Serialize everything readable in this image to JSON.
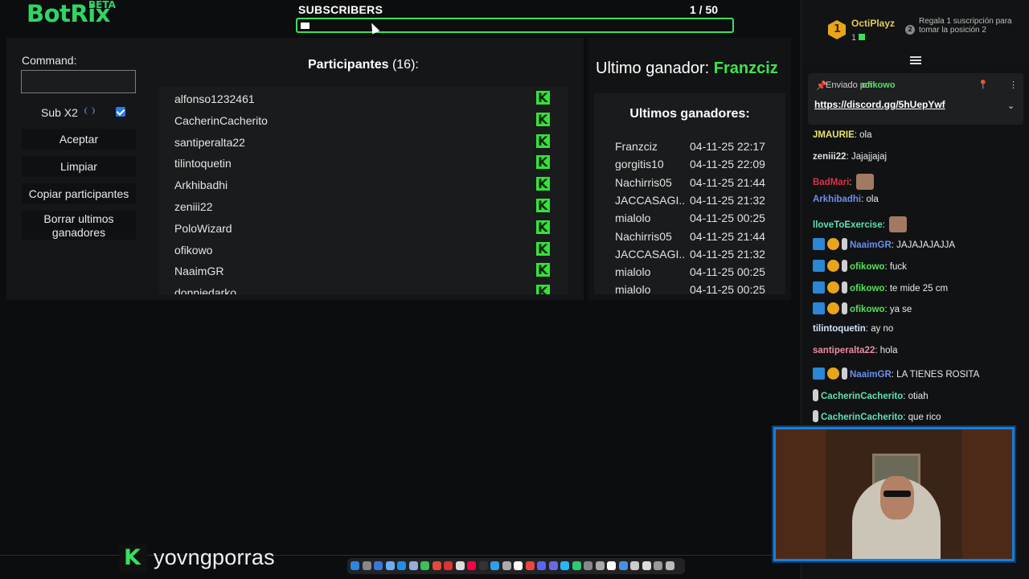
{
  "botrix": {
    "logo": "BotRix",
    "beta": "BETA"
  },
  "subscribers": {
    "label": "SUBSCRIBERS",
    "count": "1  / 50",
    "progress": 0.02
  },
  "form": {
    "command_label": "Command:",
    "command_value": "",
    "subx2_label": "Sub X2",
    "subx2_checked": true,
    "buttons": {
      "accept": "Aceptar",
      "clear": "Limpiar",
      "copy": "Copiar participantes",
      "delete_line1": "Borrar ultimos",
      "delete_line2": "ganadores"
    }
  },
  "participants": {
    "title": "Participantes",
    "count": "(16):",
    "names": [
      "alfonso1232461",
      "CacherinCacherito",
      "santiperalta22",
      "tilintoquetin",
      "Arkhibadhi",
      "zeniii22",
      "PoloWizard",
      "ofikowo",
      "NaaimGR",
      "donniedarko"
    ]
  },
  "winners": {
    "last_label": "Ultimo ganador:",
    "last_name": "Franzciz",
    "list_title": "Ultimos ganadores:",
    "rows": [
      {
        "name": "Franzciz",
        "date": "04-11-25 22:17"
      },
      {
        "name": "gorgitis10",
        "date": "04-11-25 22:09"
      },
      {
        "name": "Nachirris05",
        "date": "04-11-25 21:44"
      },
      {
        "name": "JACCASAGI...",
        "date": "04-11-25 21:32"
      },
      {
        "name": "mialolo",
        "date": "04-11-25 00:25"
      },
      {
        "name": "Nachirris05",
        "date": "04-11-25 21:44"
      },
      {
        "name": "JACCASAGI...",
        "date": "04-11-25 21:32"
      },
      {
        "name": "mialolo",
        "date": "04-11-25 00:25"
      },
      {
        "name": "mialolo",
        "date": "04-11-25 00:25"
      }
    ]
  },
  "stream": {
    "channel": "yovngporras"
  },
  "chat": {
    "gifter": {
      "name": "OctiPlayz",
      "count": "1",
      "rank": "2",
      "badge_num": "1",
      "text": "Regala 1 suscripción para tomar la posición 2"
    },
    "pinned": {
      "by_label": "Enviado por",
      "user": "ofikowo",
      "link": "https://discord.gg/5hUepYwf"
    },
    "messages": [
      {
        "user": "JMAURIE",
        "color": "#e8e36a",
        "text": "ola",
        "badges": []
      },
      {
        "user": "zeniii22",
        "color": "#e0e0e0",
        "text": "Jajajjajaj",
        "badges": []
      },
      {
        "user": "BadMari",
        "color": "#d8334a",
        "text": "",
        "badges": [],
        "emote": true
      },
      {
        "user": "Arkhibadhi",
        "color": "#6b8ff0",
        "text": "ola",
        "badges": []
      },
      {
        "user": "lloveToExercise",
        "color": "#5fe0b2",
        "text": "",
        "badges": [],
        "emote": true
      },
      {
        "user": "NaaimGR",
        "color": "#6b8ff0",
        "text": "JAJAJAJAJJA",
        "badges": [
          "mod",
          "sub",
          "gift"
        ]
      },
      {
        "user": "ofikowo",
        "color": "#53e05a",
        "text": "fuck",
        "badges": [
          "mod",
          "sub",
          "gift"
        ]
      },
      {
        "user": "ofikowo",
        "color": "#53e05a",
        "text": "te mide 25 cm",
        "badges": [
          "mod",
          "sub",
          "gift"
        ]
      },
      {
        "user": "ofikowo",
        "color": "#53e05a",
        "text": "ya se",
        "badges": [
          "mod",
          "sub",
          "gift"
        ]
      },
      {
        "user": "tilintoquetin",
        "color": "#cfe4ff",
        "text": "ay no",
        "badges": []
      },
      {
        "user": "santiperalta22",
        "color": "#ef8aa6",
        "text": "hola",
        "badges": []
      },
      {
        "user": "NaaimGR",
        "color": "#6b8ff0",
        "text": "LA TIENES ROSITA",
        "badges": [
          "mod",
          "sub",
          "gift"
        ]
      },
      {
        "user": "CacherinCacherito",
        "color": "#5fe0b2",
        "text": "otiah",
        "badges": [
          "gift"
        ]
      },
      {
        "user": "CacherinCacherito",
        "color": "#5fe0b2",
        "text": "que rico",
        "badges": [
          "gift"
        ]
      }
    ]
  },
  "colors": {
    "accent": "#2fd663",
    "kick": "#34e33a",
    "mod": "#2b86d4",
    "sub": "#e8a51c"
  }
}
